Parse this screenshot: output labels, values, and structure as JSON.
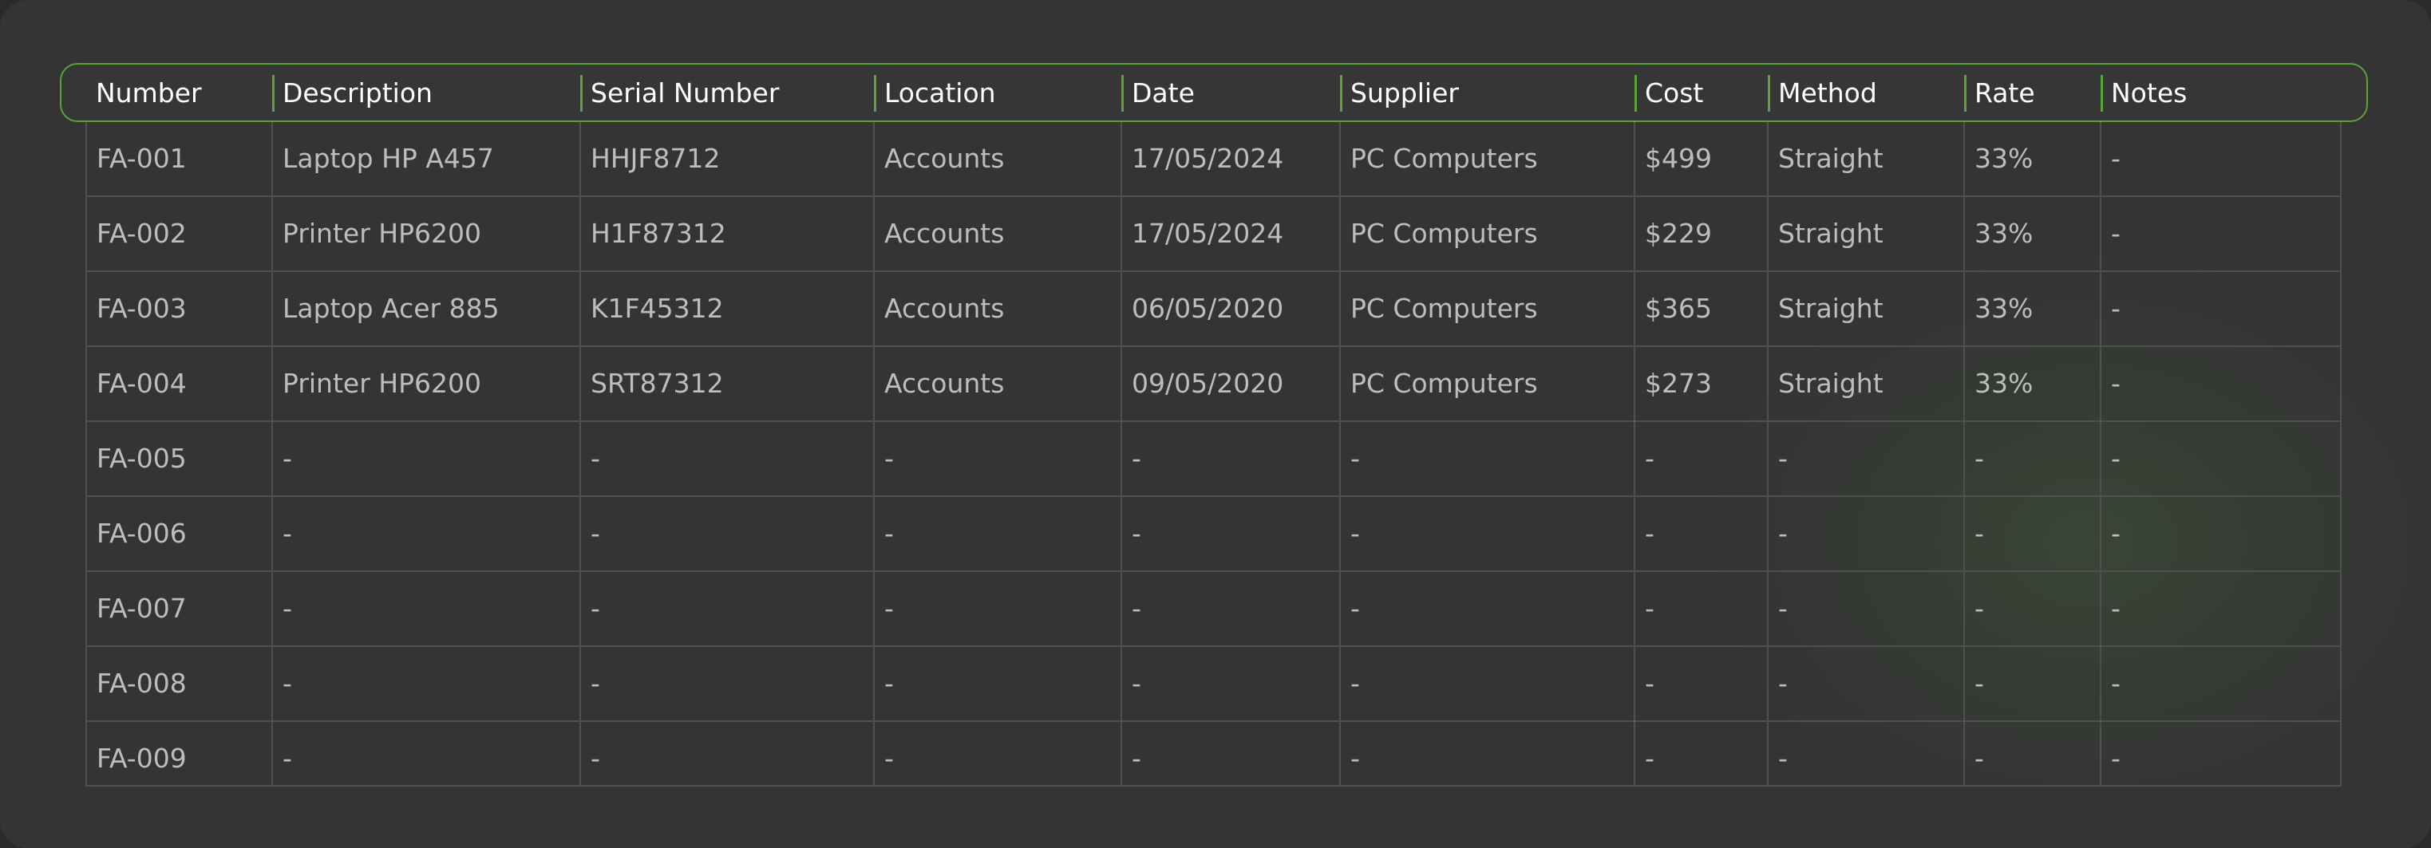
{
  "table": {
    "columns": [
      "Number",
      "Description",
      "Serial Number",
      "Location",
      "Date",
      "Supplier",
      "Cost",
      "Method",
      "Rate",
      "Notes"
    ],
    "rows": [
      [
        "FA-001",
        "Laptop HP A457",
        "HHJF8712",
        "Accounts",
        "17/05/2024",
        "PC Computers",
        "$499",
        "Straight",
        "33%",
        "-"
      ],
      [
        "FA-002",
        "Printer HP6200",
        "H1F87312",
        "Accounts",
        "17/05/2024",
        "PC Computers",
        "$229",
        "Straight",
        "33%",
        "-"
      ],
      [
        "FA-003",
        "Laptop Acer 885",
        "K1F45312",
        "Accounts",
        "06/05/2020",
        "PC Computers",
        "$365",
        "Straight",
        "33%",
        "-"
      ],
      [
        "FA-004",
        "Printer HP6200",
        "SRT87312",
        "Accounts",
        "09/05/2020",
        "PC Computers",
        "$273",
        "Straight",
        "33%",
        "-"
      ],
      [
        "FA-005",
        "-",
        "-",
        "-",
        "-",
        "-",
        "-",
        "-",
        "-",
        "-"
      ],
      [
        "FA-006",
        "-",
        "-",
        "-",
        "-",
        "-",
        "-",
        "-",
        "-",
        "-"
      ],
      [
        "FA-007",
        "-",
        "-",
        "-",
        "-",
        "-",
        "-",
        "-",
        "-",
        "-"
      ],
      [
        "FA-008",
        "-",
        "-",
        "-",
        "-",
        "-",
        "-",
        "-",
        "-",
        "-"
      ],
      [
        "FA-009",
        "-",
        "-",
        "-",
        "-",
        "-",
        "-",
        "-",
        "-",
        "-"
      ]
    ]
  },
  "colors": {
    "background": "#343434",
    "accent": "#5aa33a",
    "header_text": "#ffffff",
    "cell_text": "#bdbdbd",
    "grid": "#505050"
  }
}
